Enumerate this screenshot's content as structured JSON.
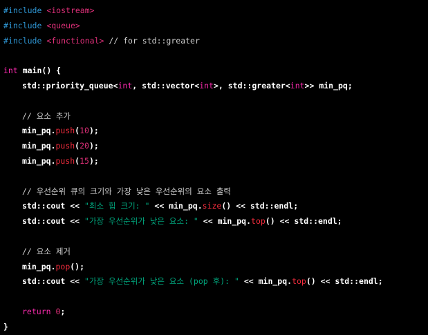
{
  "colors": {
    "background": "#000000",
    "keyword": "#f92aad",
    "preprocessor": "#2e95d3",
    "header": "#df3079",
    "string": "#00a67d",
    "number": "#df3079",
    "function": "#f22c3d",
    "comment": "#cfcfcf",
    "text": "#ffffff"
  },
  "lines": [
    {
      "indent": 0,
      "tokens": [
        {
          "t": "#include",
          "c": "inc"
        },
        {
          "t": " ",
          "c": "plain"
        },
        {
          "t": "<iostream>",
          "c": "hdr"
        }
      ]
    },
    {
      "indent": 0,
      "tokens": [
        {
          "t": "#include",
          "c": "inc"
        },
        {
          "t": " ",
          "c": "plain"
        },
        {
          "t": "<queue>",
          "c": "hdr"
        }
      ]
    },
    {
      "indent": 0,
      "tokens": [
        {
          "t": "#include",
          "c": "inc"
        },
        {
          "t": " ",
          "c": "plain"
        },
        {
          "t": "<functional>",
          "c": "hdr"
        },
        {
          "t": " // for std::greater",
          "c": "cm"
        }
      ]
    },
    {
      "indent": 0,
      "tokens": []
    },
    {
      "indent": 0,
      "tokens": [
        {
          "t": "int",
          "c": "kw"
        },
        {
          "t": " main() {",
          "c": "plain bold"
        }
      ]
    },
    {
      "indent": 1,
      "tokens": [
        {
          "t": "std::priority_queue<",
          "c": "plain bold"
        },
        {
          "t": "int",
          "c": "kw"
        },
        {
          "t": ", std::vector<",
          "c": "plain bold"
        },
        {
          "t": "int",
          "c": "kw"
        },
        {
          "t": ">, std::greater<",
          "c": "plain bold"
        },
        {
          "t": "int",
          "c": "kw"
        },
        {
          "t": ">> min_pq;",
          "c": "plain bold"
        }
      ]
    },
    {
      "indent": 0,
      "tokens": []
    },
    {
      "indent": 1,
      "tokens": [
        {
          "t": "// 요소 추가",
          "c": "cmk"
        }
      ]
    },
    {
      "indent": 1,
      "tokens": [
        {
          "t": "min_pq.",
          "c": "plain bold"
        },
        {
          "t": "push",
          "c": "fn"
        },
        {
          "t": "(",
          "c": "plain bold"
        },
        {
          "t": "10",
          "c": "num"
        },
        {
          "t": ");",
          "c": "plain bold"
        }
      ]
    },
    {
      "indent": 1,
      "tokens": [
        {
          "t": "min_pq.",
          "c": "plain bold"
        },
        {
          "t": "push",
          "c": "fn"
        },
        {
          "t": "(",
          "c": "plain bold"
        },
        {
          "t": "20",
          "c": "num"
        },
        {
          "t": ");",
          "c": "plain bold"
        }
      ]
    },
    {
      "indent": 1,
      "tokens": [
        {
          "t": "min_pq.",
          "c": "plain bold"
        },
        {
          "t": "push",
          "c": "fn"
        },
        {
          "t": "(",
          "c": "plain bold"
        },
        {
          "t": "15",
          "c": "num"
        },
        {
          "t": ");",
          "c": "plain bold"
        }
      ]
    },
    {
      "indent": 0,
      "tokens": []
    },
    {
      "indent": 1,
      "tokens": [
        {
          "t": "// 우선순위 큐의 크기와 가장 낮은 우선순위의 요소 출력",
          "c": "cmk"
        }
      ]
    },
    {
      "indent": 1,
      "tokens": [
        {
          "t": "std::cout << ",
          "c": "plain bold"
        },
        {
          "t": "\"최소 힙 크기: \"",
          "c": "str"
        },
        {
          "t": " << min_pq.",
          "c": "plain bold"
        },
        {
          "t": "size",
          "c": "fn"
        },
        {
          "t": "() << std::endl;",
          "c": "plain bold"
        }
      ]
    },
    {
      "indent": 1,
      "tokens": [
        {
          "t": "std::cout << ",
          "c": "plain bold"
        },
        {
          "t": "\"가장 우선순위가 낮은 요소: \"",
          "c": "str"
        },
        {
          "t": " << min_pq.",
          "c": "plain bold"
        },
        {
          "t": "top",
          "c": "fn"
        },
        {
          "t": "() << std::endl;",
          "c": "plain bold"
        }
      ]
    },
    {
      "indent": 0,
      "tokens": []
    },
    {
      "indent": 1,
      "tokens": [
        {
          "t": "// 요소 제거",
          "c": "cmk"
        }
      ]
    },
    {
      "indent": 1,
      "tokens": [
        {
          "t": "min_pq.",
          "c": "plain bold"
        },
        {
          "t": "pop",
          "c": "fn"
        },
        {
          "t": "();",
          "c": "plain bold"
        }
      ]
    },
    {
      "indent": 1,
      "tokens": [
        {
          "t": "std::cout << ",
          "c": "plain bold"
        },
        {
          "t": "\"가장 우선순위가 낮은 요소 (pop 후): \"",
          "c": "str"
        },
        {
          "t": " << min_pq.",
          "c": "plain bold"
        },
        {
          "t": "top",
          "c": "fn"
        },
        {
          "t": "() << std::endl;",
          "c": "plain bold"
        }
      ]
    },
    {
      "indent": 0,
      "tokens": []
    },
    {
      "indent": 1,
      "tokens": [
        {
          "t": "return",
          "c": "kw"
        },
        {
          "t": " ",
          "c": "plain"
        },
        {
          "t": "0",
          "c": "num"
        },
        {
          "t": ";",
          "c": "plain bold"
        }
      ]
    },
    {
      "indent": 0,
      "tokens": [
        {
          "t": "}",
          "c": "plain bold"
        }
      ]
    }
  ]
}
